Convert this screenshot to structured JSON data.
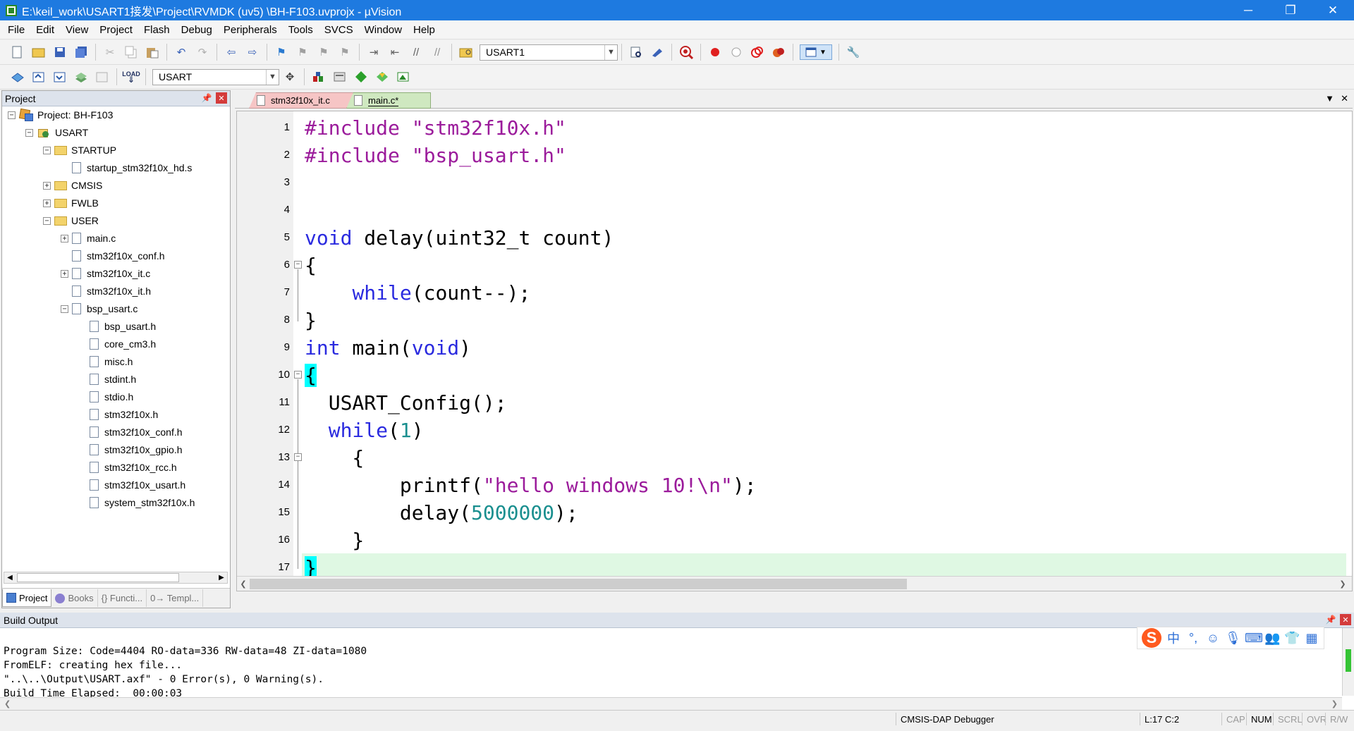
{
  "window": {
    "title": "E:\\keil_work\\USART1接发\\Project\\RVMDK  (uv5)  \\BH-F103.uvprojx - µVision",
    "minimize": "─",
    "restore": "❐",
    "close": "✕"
  },
  "menu": [
    "File",
    "Edit",
    "View",
    "Project",
    "Flash",
    "Debug",
    "Peripherals",
    "Tools",
    "SVCS",
    "Window",
    "Help"
  ],
  "toolbar1": {
    "find_combo": "USART1"
  },
  "toolbar2": {
    "target_combo": "USART"
  },
  "project_panel": {
    "title": "Project",
    "tree": [
      {
        "label": "Project: BH-F103",
        "level": 0,
        "expander": "−",
        "icon": "project-icon"
      },
      {
        "label": "USART",
        "level": 1,
        "expander": "−",
        "icon": "target-icon"
      },
      {
        "label": "STARTUP",
        "level": 2,
        "expander": "−",
        "icon": "folder-open-icon"
      },
      {
        "label": "startup_stm32f10x_hd.s",
        "level": 3,
        "expander": "",
        "icon": "file-icon"
      },
      {
        "label": "CMSIS",
        "level": 2,
        "expander": "+",
        "icon": "folder-icon"
      },
      {
        "label": "FWLB",
        "level": 2,
        "expander": "+",
        "icon": "folder-icon"
      },
      {
        "label": "USER",
        "level": 2,
        "expander": "−",
        "icon": "folder-open-icon"
      },
      {
        "label": "main.c",
        "level": 3,
        "expander": "+",
        "icon": "file-icon"
      },
      {
        "label": "stm32f10x_conf.h",
        "level": 3,
        "expander": "",
        "icon": "file-icon"
      },
      {
        "label": "stm32f10x_it.c",
        "level": 3,
        "expander": "+",
        "icon": "file-icon"
      },
      {
        "label": "stm32f10x_it.h",
        "level": 3,
        "expander": "",
        "icon": "file-icon"
      },
      {
        "label": "bsp_usart.c",
        "level": 3,
        "expander": "−",
        "icon": "file-icon"
      },
      {
        "label": "bsp_usart.h",
        "level": 4,
        "expander": "",
        "icon": "file-icon"
      },
      {
        "label": "core_cm3.h",
        "level": 4,
        "expander": "",
        "icon": "file-icon"
      },
      {
        "label": "misc.h",
        "level": 4,
        "expander": "",
        "icon": "file-icon"
      },
      {
        "label": "stdint.h",
        "level": 4,
        "expander": "",
        "icon": "file-icon"
      },
      {
        "label": "stdio.h",
        "level": 4,
        "expander": "",
        "icon": "file-icon"
      },
      {
        "label": "stm32f10x.h",
        "level": 4,
        "expander": "",
        "icon": "file-icon"
      },
      {
        "label": "stm32f10x_conf.h",
        "level": 4,
        "expander": "",
        "icon": "file-icon"
      },
      {
        "label": "stm32f10x_gpio.h",
        "level": 4,
        "expander": "",
        "icon": "file-icon"
      },
      {
        "label": "stm32f10x_rcc.h",
        "level": 4,
        "expander": "",
        "icon": "file-icon"
      },
      {
        "label": "stm32f10x_usart.h",
        "level": 4,
        "expander": "",
        "icon": "file-icon"
      },
      {
        "label": "system_stm32f10x.h",
        "level": 4,
        "expander": "",
        "icon": "file-icon"
      }
    ],
    "tabs": [
      {
        "label": "Project",
        "icon": "project-tab-icon",
        "active": true
      },
      {
        "label": "Books",
        "icon": "books-icon",
        "active": false
      },
      {
        "label": "{} Functi...",
        "icon": "",
        "active": false
      },
      {
        "label": "0→ Templ...",
        "icon": "",
        "active": false
      }
    ]
  },
  "editor": {
    "tabs": [
      {
        "label": "stm32f10x_it.c",
        "active": false
      },
      {
        "label": "main.c*",
        "active": true
      }
    ],
    "lines": [
      [
        [
          "pp",
          "#include "
        ],
        [
          "str",
          "\"stm32f10x.h\""
        ]
      ],
      [
        [
          "pp",
          "#include "
        ],
        [
          "str",
          "\"bsp_usart.h\""
        ]
      ],
      [],
      [],
      [
        [
          "kw",
          "void"
        ],
        [
          "",
          " delay(uint32_t count)"
        ]
      ],
      [
        [
          "",
          "{"
        ]
      ],
      [
        [
          "",
          "    "
        ],
        [
          "kw",
          "while"
        ],
        [
          "",
          "(count--);"
        ]
      ],
      [
        [
          "",
          "}"
        ]
      ],
      [
        [
          "kw",
          "int"
        ],
        [
          "",
          " main("
        ],
        [
          "kw",
          "void"
        ],
        [
          "",
          ")"
        ]
      ],
      [
        [
          "hl",
          "{"
        ]
      ],
      [
        [
          "",
          "  USART_Config();"
        ]
      ],
      [
        [
          "",
          "  "
        ],
        [
          "kw",
          "while"
        ],
        [
          "",
          "("
        ],
        [
          "num",
          "1"
        ],
        [
          "",
          ")"
        ]
      ],
      [
        [
          "",
          "    {"
        ]
      ],
      [
        [
          "",
          "        printf("
        ],
        [
          "str",
          "\"hello windows 10!\\n\""
        ],
        [
          "",
          ");"
        ]
      ],
      [
        [
          "",
          "        delay("
        ],
        [
          "num",
          "5000000"
        ],
        [
          "",
          ");"
        ]
      ],
      [
        [
          "",
          "    }"
        ]
      ],
      [
        [
          "hl",
          "}"
        ]
      ]
    ],
    "fold_markers": {
      "6": "−",
      "10": "−",
      "13": "−"
    },
    "current_line": 17
  },
  "build_output": {
    "title": "Build Output",
    "lines": [
      "Program Size: Code=4404 RO-data=336 RW-data=48 ZI-data=1080",
      "FromELF: creating hex file...",
      "\"..\\..\\Output\\USART.axf\" - 0 Error(s), 0 Warning(s).",
      "Build Time Elapsed:  00:00:03"
    ],
    "ime": {
      "logo": "S",
      "mode": "中",
      "punct": "°,"
    }
  },
  "status": {
    "debugger": "CMSIS-DAP Debugger",
    "position": "L:17 C:2",
    "caps": "CAP",
    "num": "NUM",
    "scrl": "SCRL",
    "ovr": "OVR",
    "rw": "R/W"
  }
}
